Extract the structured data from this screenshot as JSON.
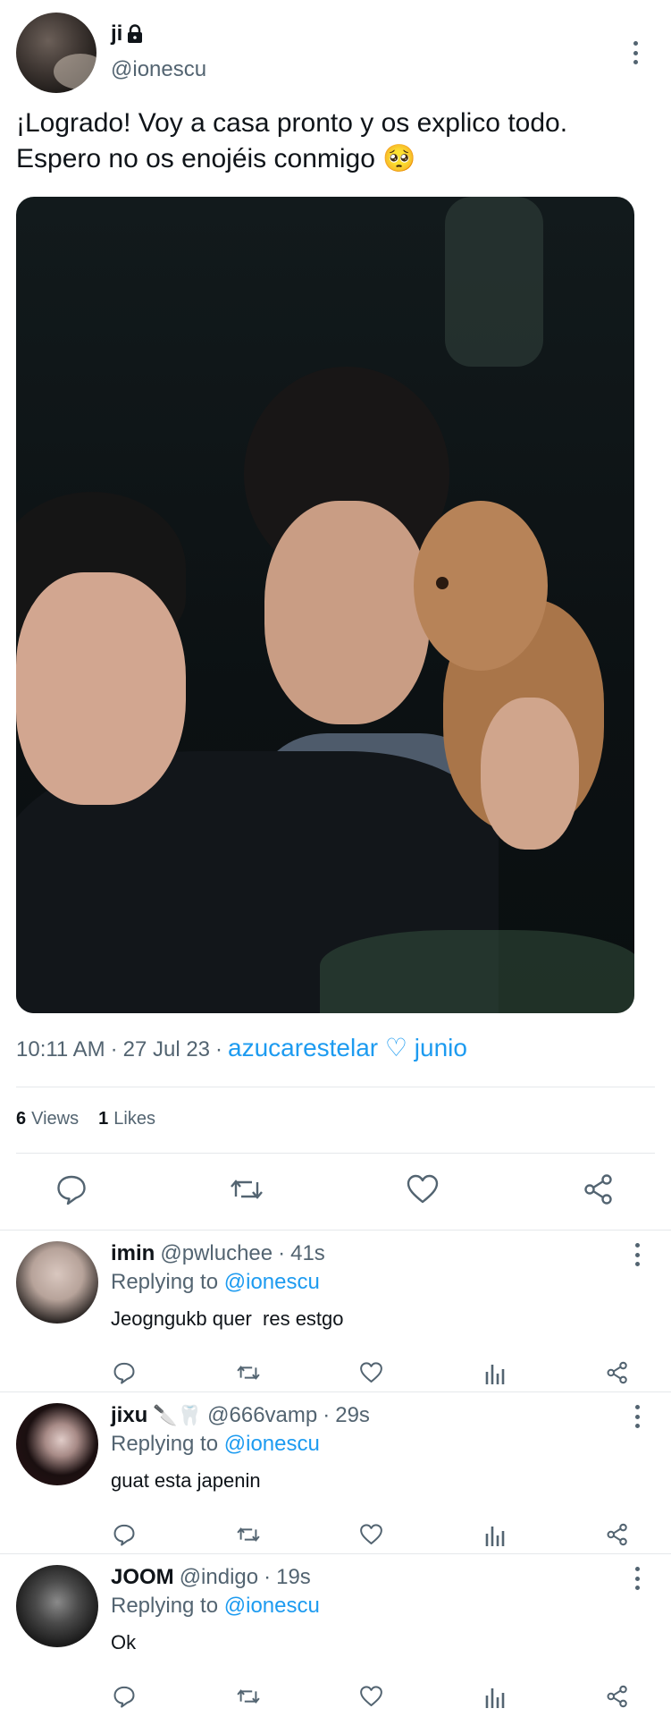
{
  "tweet": {
    "author": {
      "name": "ji",
      "handle": "@ionescu",
      "locked_icon": "lock-icon"
    },
    "text_line1": "¡Logrado! Voy a casa pronto y os explico todo.",
    "text_line2": "Espero no os enojéis conmigo 🥺",
    "time": "10:11 AM",
    "sep1": "·",
    "date": "27 Jul 23",
    "sep2": "·",
    "source": "azucarestelar ♡ junio",
    "views_count": "6",
    "views_label": "Views",
    "likes_count": "1",
    "likes_label": "Likes"
  },
  "replies": [
    {
      "name": "imin",
      "handle": "@pwluchee",
      "sep": "·",
      "time": "41s",
      "replying_label": "Replying to",
      "mention": "@ionescu",
      "text": "Jeogngukb quer  res estgo"
    },
    {
      "name": "jixu",
      "name_emoji": "🔪🦷",
      "handle": "@666vamp",
      "sep": "·",
      "time": "29s",
      "replying_label": "Replying to",
      "mention": "@ionescu",
      "text": "guat esta japenin"
    },
    {
      "name": "JOOM",
      "handle": "@indigo",
      "sep": "·",
      "time": "19s",
      "replying_label": "Replying to",
      "mention": "@ionescu",
      "text": "Ok"
    }
  ],
  "colors": {
    "link": "#1d9bf0",
    "secondary_text": "#536471",
    "primary_text": "#0f1419",
    "divider": "#e5e8eb"
  }
}
